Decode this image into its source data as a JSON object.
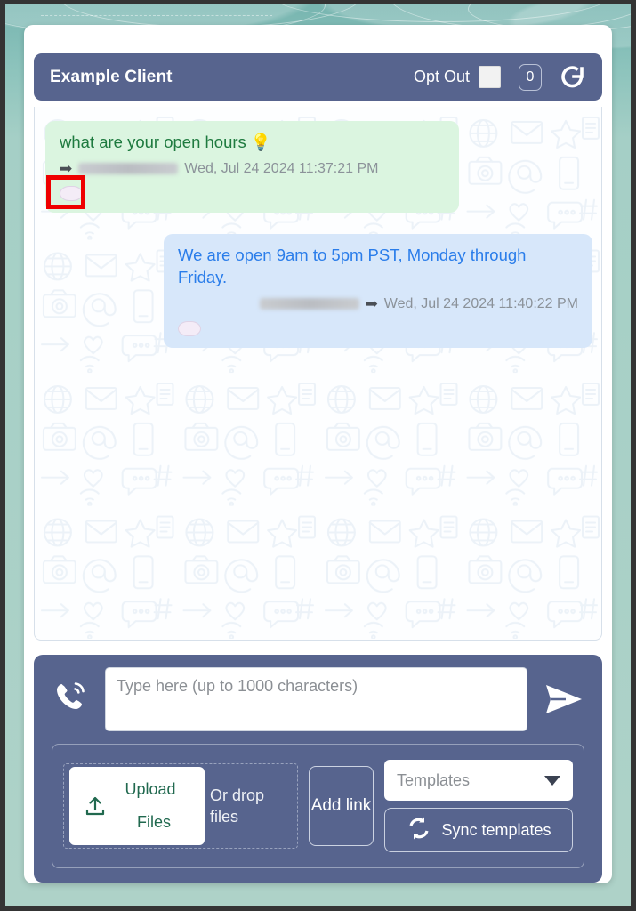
{
  "header": {
    "title": "Example Client",
    "opt_out_label": "Opt Out",
    "opt_out_checked": false,
    "count_badge": "0",
    "refresh_icon": "refresh-icon",
    "bar_color": "#57648e"
  },
  "conversation": {
    "messages": [
      {
        "direction": "inbound",
        "text": "what are your open hours 💡",
        "sender": "[redacted]",
        "sender_redacted": true,
        "direction_glyph": "➡",
        "timestamp": "Wed, Jul 24 2024 11:37:21 PM",
        "bubble_color": "#dbf5e0",
        "text_color": "#1e7a3f",
        "footer_icon": "chat-bubble-icon",
        "highlighted": true
      },
      {
        "direction": "outbound",
        "text": "We are open 9am to 5pm PST, Monday through Friday.",
        "sender": "[redacted]",
        "sender_redacted": true,
        "direction_glyph": "➡",
        "timestamp": "Wed, Jul 24 2024 11:40:22 PM",
        "bubble_color": "#d7e7fa",
        "text_color": "#2a7dea",
        "footer_icon": "chat-bubble-icon",
        "highlighted": false
      }
    ]
  },
  "composer": {
    "phone_icon": "phone-ring-icon",
    "input_value": "",
    "input_placeholder": "Type here (up to 1000 characters)",
    "send_icon": "send-paper-plane-icon"
  },
  "toolbar": {
    "upload_icon": "upload-icon",
    "upload_label_line1": "Upload",
    "upload_label_line2": "Files",
    "drop_text": "Or drop files",
    "add_link_label": "Add link",
    "templates_value": "Templates",
    "templates_caret": "chevron-down-icon",
    "sync_icon": "sync-icon",
    "sync_label": "Sync templates"
  },
  "annotation": {
    "color": "#ef0000",
    "target": "inbound-message-chat-bubble-icon"
  },
  "theme": {
    "page_bg_top": "#77b5b0",
    "page_bg_bottom": "#aed2c8",
    "card_bg": "#ffffff",
    "panel_blue": "#57648e",
    "inbound_green": "#dbf5e0",
    "outbound_blue": "#d7e7fa",
    "upload_text_green": "#21694f"
  }
}
